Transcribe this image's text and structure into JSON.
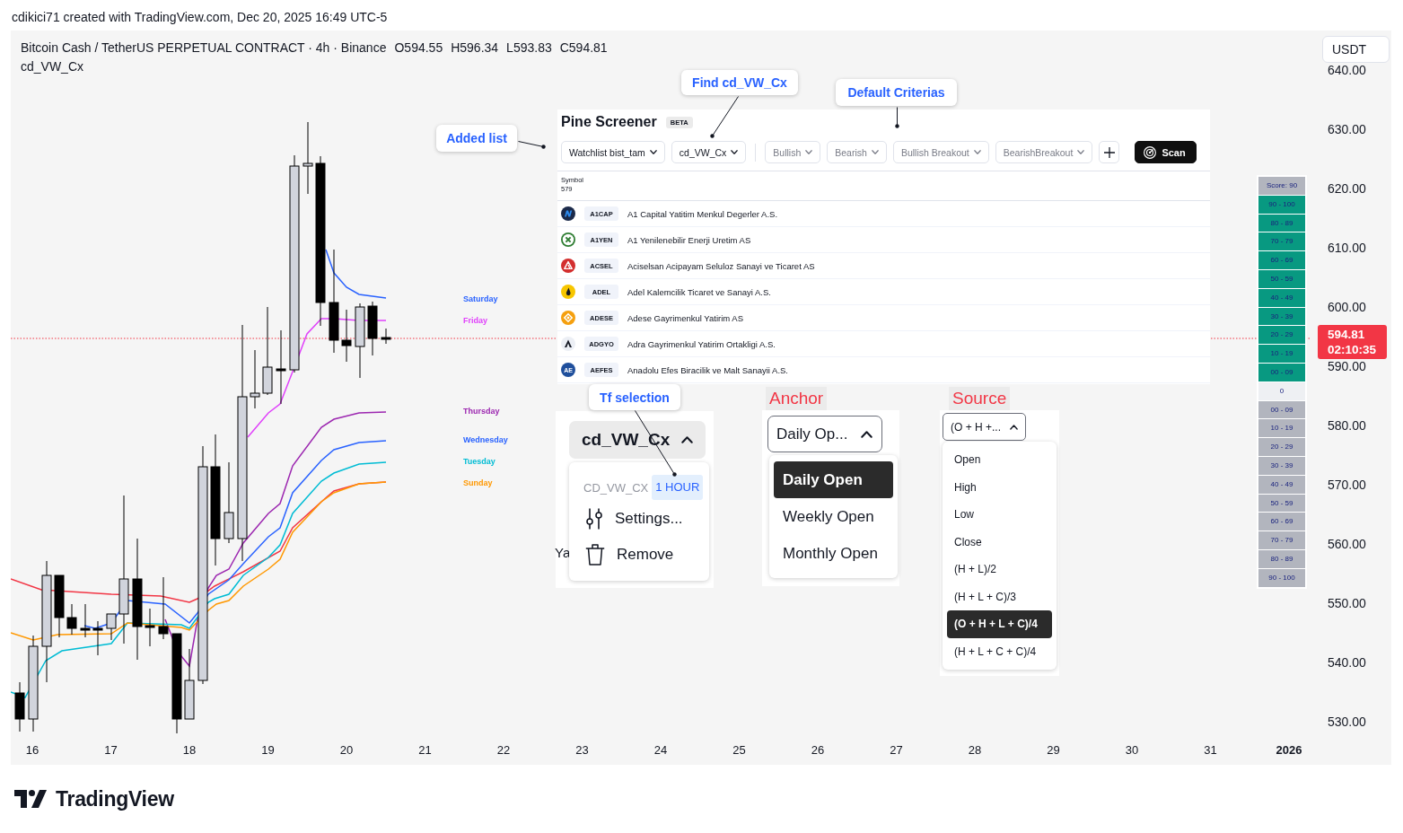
{
  "attribution": "cdikici71 created with TradingView.com, Dec 20, 2025 16:49 UTC-5",
  "chart": {
    "legend": {
      "symbol": "Bitcoin Cash / TetherUS PERPETUAL CONTRACT · 4h · Binance",
      "ohlc": [
        "O594.55",
        "H596.34",
        "L593.83",
        "C594.81"
      ],
      "indicator": "cd_VW_Cx"
    },
    "currency_button": "USDT",
    "price_axis": [
      "640.00",
      "630.00",
      "620.00",
      "610.00",
      "600.00",
      "590.00",
      "580.00",
      "570.00",
      "560.00",
      "550.00",
      "540.00",
      "530.00"
    ],
    "last_price": {
      "price": "594.81",
      "countdown": "02:10:35"
    },
    "time_axis": [
      {
        "label": "16",
        "kind": "day"
      },
      {
        "label": "17",
        "kind": "day"
      },
      {
        "label": "18",
        "kind": "day"
      },
      {
        "label": "19",
        "kind": "day"
      },
      {
        "label": "20",
        "kind": "day"
      },
      {
        "label": "21",
        "kind": "day"
      },
      {
        "label": "22",
        "kind": "day"
      },
      {
        "label": "23",
        "kind": "day"
      },
      {
        "label": "24",
        "kind": "day"
      },
      {
        "label": "25",
        "kind": "day"
      },
      {
        "label": "26",
        "kind": "day"
      },
      {
        "label": "27",
        "kind": "day"
      },
      {
        "label": "28",
        "kind": "day"
      },
      {
        "label": "29",
        "kind": "day"
      },
      {
        "label": "30",
        "kind": "day"
      },
      {
        "label": "31",
        "kind": "day"
      },
      {
        "label": "2026",
        "kind": "year"
      }
    ],
    "series_labels": [
      {
        "label": "Saturday",
        "color": "#2962ff"
      },
      {
        "label": "Friday",
        "color": "#e040fb"
      },
      {
        "label": "Thursday",
        "color": "#9c27b0"
      },
      {
        "label": "Wednesday",
        "color": "#2962ff"
      },
      {
        "label": "Tuesday",
        "color": "#00bcd4"
      },
      {
        "label": "Sunday",
        "color": "#ff9800"
      }
    ]
  },
  "callouts": [
    "Find cd_VW_Cx",
    "Default Criterias",
    "Added list",
    "Tf selection"
  ],
  "pine_screener": {
    "title": "Pine Screener",
    "badge": "BETA",
    "selectors": [
      {
        "label": "Watchlist bist_tam",
        "disabled": false
      },
      {
        "label": "cd_VW_Cx",
        "disabled": false
      }
    ],
    "criteria": [
      {
        "label": "Bullish",
        "disabled": true
      },
      {
        "label": "Bearish",
        "disabled": true
      },
      {
        "label": "Bullish Breakout",
        "disabled": true
      },
      {
        "label": "BearishBreakout",
        "disabled": true
      }
    ],
    "scan_button": "Scan",
    "column_header": "Symbol",
    "count": "579",
    "rows": [
      {
        "ticker": "A1CAP",
        "name": "A1 Capital Yatitim Menkul Degerler A.S.",
        "logo": {
          "kind": "n-mark",
          "color": "#1b2a4a"
        }
      },
      {
        "ticker": "A1YEN",
        "name": "A1 Yenilenebilir Enerji Uretim AS",
        "logo": {
          "kind": "x-ring",
          "color": "#2e7d32"
        }
      },
      {
        "ticker": "ACSEL",
        "name": "Aciselsan Acipayam Seluloz Sanayi ve Ticaret AS",
        "logo": {
          "kind": "triangle",
          "color": "#d32f2f"
        }
      },
      {
        "ticker": "ADEL",
        "name": "Adel Kalemcilik Ticaret ve Sanayi A.S.",
        "logo": {
          "kind": "drop",
          "color": "#f7c600"
        }
      },
      {
        "ticker": "ADESE",
        "name": "Adese Gayrimenkul Yatirim AS",
        "logo": {
          "kind": "diamond",
          "color": "#f5a00f"
        }
      },
      {
        "ticker": "ADGYO",
        "name": "Adra Gayrimenkul Yatirim Ortakligi A.S.",
        "logo": {
          "kind": "peak",
          "color": "#eceff5"
        }
      },
      {
        "ticker": "AEFES",
        "name": "Anadolu Efes Biracilik ve Malt Sanayii A.S.",
        "logo": {
          "kind": "text",
          "text": "AE",
          "color": "#1f4f9c"
        }
      }
    ]
  },
  "score_legend": {
    "title": "Score: 90",
    "cells": [
      {
        "label": "90 - 100",
        "color": "#089981"
      },
      {
        "label": "80 - 89",
        "color": "#089981"
      },
      {
        "label": "70 - 79",
        "color": "#089981"
      },
      {
        "label": "60 - 69",
        "color": "#089981"
      },
      {
        "label": "50 - 59",
        "color": "#089981"
      },
      {
        "label": "40 - 49",
        "color": "#089981"
      },
      {
        "label": "30 - 39",
        "color": "#089981"
      },
      {
        "label": "20 - 29",
        "color": "#089981"
      },
      {
        "label": "10 - 19",
        "color": "#089981"
      },
      {
        "label": "00 - 09",
        "color": "#089981"
      },
      {
        "label": "0",
        "color": "#eef0f3"
      },
      {
        "label": "00 - 09",
        "color": "#b2b5be"
      },
      {
        "label": "10 - 19",
        "color": "#b2b5be"
      },
      {
        "label": "20 - 29",
        "color": "#b2b5be"
      },
      {
        "label": "30 - 39",
        "color": "#b2b5be"
      },
      {
        "label": "40 - 49",
        "color": "#b2b5be"
      },
      {
        "label": "50 - 59",
        "color": "#b2b5be"
      },
      {
        "label": "60 - 69",
        "color": "#b2b5be"
      },
      {
        "label": "70 - 79",
        "color": "#b2b5be"
      },
      {
        "label": "80 - 89",
        "color": "#b2b5be"
      },
      {
        "label": "90 - 100",
        "color": "#b2b5be"
      }
    ]
  },
  "tf_menu": {
    "button": "cd_VW_Cx",
    "expanded": true,
    "indicator": "CD_VW_CX",
    "timeframe": "1 HOUR",
    "items": [
      {
        "label": "Settings...",
        "kind": "settings"
      },
      {
        "label": "Remove",
        "kind": "remove"
      }
    ],
    "behind_text": "Ya"
  },
  "anchor": {
    "label": "Anchor",
    "value": "Daily Op...",
    "expanded": true,
    "options": [
      {
        "label": "Daily Open",
        "selected": true
      },
      {
        "label": "Weekly Open",
        "selected": false
      },
      {
        "label": "Monthly Open",
        "selected": false
      }
    ]
  },
  "source": {
    "label": "Source",
    "value": "(O + H +...",
    "expanded": true,
    "options": [
      {
        "label": "Open",
        "selected": false
      },
      {
        "label": "High",
        "selected": false
      },
      {
        "label": "Low",
        "selected": false
      },
      {
        "label": "Close",
        "selected": false
      },
      {
        "label": "(H + L)/2",
        "selected": false
      },
      {
        "label": "(H + L + C)/3",
        "selected": false
      },
      {
        "label": "(O + H + L + C)/4",
        "selected": true
      },
      {
        "label": "(H + L + C + C)/4",
        "selected": false
      }
    ]
  },
  "footer": {
    "brand": "TradingView"
  }
}
